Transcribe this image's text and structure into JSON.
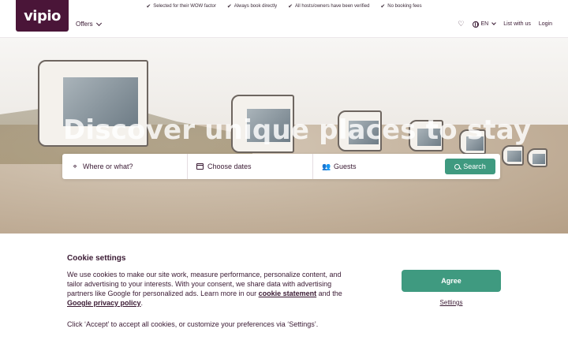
{
  "topbar": {
    "usps": [
      "Selected for their WOW factor",
      "Always book directly",
      "All hosts/owners have been verified",
      "No booking fees"
    ]
  },
  "header": {
    "logo": "vipio",
    "offers_label": "Offers",
    "language": "EN",
    "list_with_us": "List with us",
    "login": "Login"
  },
  "hero": {
    "title": "Discover unique places to stay"
  },
  "search": {
    "where_placeholder": "Where or what?",
    "dates_placeholder": "Choose dates",
    "guests_placeholder": "Guests",
    "button_label": "Search"
  },
  "cookie": {
    "title": "Cookie settings",
    "text_part1": "We use cookies to make our site work, measure performance, personalize content, and tailor advertising to your interests. With your consent, we share data with advertising partners like Google for personalized ads. Learn more in our ",
    "link_cookie_statement": "cookie statement",
    "text_and": " and the ",
    "link_google_privacy": "Google privacy policy",
    "text_end": ".",
    "note": "Click ‘Accept’ to accept all cookies, or customize your preferences via ‘Settings’.",
    "accept_label": "Agree",
    "settings_label": "Settings"
  },
  "colors": {
    "brand": "#4a1538",
    "accent": "#3f9a80",
    "text": "#3a1a33"
  },
  "icons": {
    "usp": "checkmark-icon",
    "favorites": "heart-icon",
    "language": "globe-icon",
    "where": "map-pin-icon",
    "dates": "calendar-icon",
    "guests": "people-icon",
    "search": "search-icon"
  }
}
